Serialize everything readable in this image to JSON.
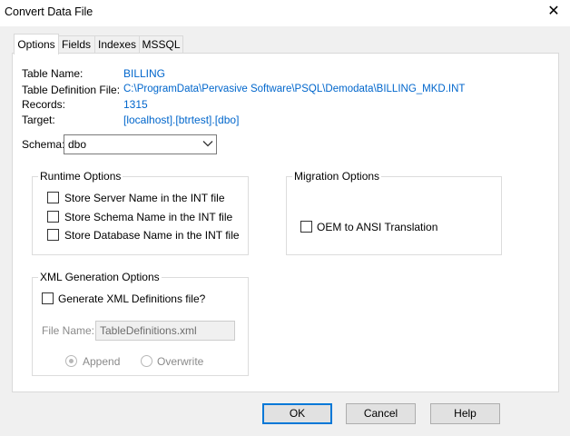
{
  "window": {
    "title": "Convert Data File",
    "close_glyph": "✕"
  },
  "tabs": [
    {
      "label": "Options",
      "active": true
    },
    {
      "label": "Fields"
    },
    {
      "label": "Indexes"
    },
    {
      "label": "MSSQL"
    }
  ],
  "info": {
    "table_name_label": "Table Name:",
    "table_name_value": "BILLING",
    "table_def_label": "Table Definition File:",
    "table_def_value": "C:\\ProgramData\\Pervasive Software\\PSQL\\Demodata\\BILLING_MKD.INT",
    "records_label": "Records:",
    "records_value": "1315",
    "target_label": "Target:",
    "target_value": "[localhost].[btrtest].[dbo]"
  },
  "schema": {
    "label": "Schema:",
    "value": "dbo"
  },
  "runtime_options": {
    "title": "Runtime Options",
    "items": [
      {
        "label": "Store Server Name in the INT file",
        "checked": false
      },
      {
        "label": "Store Schema Name in the INT file",
        "checked": false
      },
      {
        "label": "Store Database Name in the INT file",
        "checked": false
      }
    ]
  },
  "migration_options": {
    "title": "Migration Options",
    "oem_label": "OEM to ANSI Translation",
    "oem_checked": false
  },
  "xml_options": {
    "title": "XML Generation Options",
    "generate_label": "Generate XML Definitions file?",
    "generate_checked": false,
    "file_name_label": "File Name:",
    "file_name_value": "TableDefinitions.xml",
    "append_label": "Append",
    "overwrite_label": "Overwrite",
    "selected_mode": "Append"
  },
  "buttons": {
    "ok": "OK",
    "cancel": "Cancel",
    "help": "Help"
  },
  "colors": {
    "accent": "#0078d7",
    "link_blue": "#0066cc"
  }
}
